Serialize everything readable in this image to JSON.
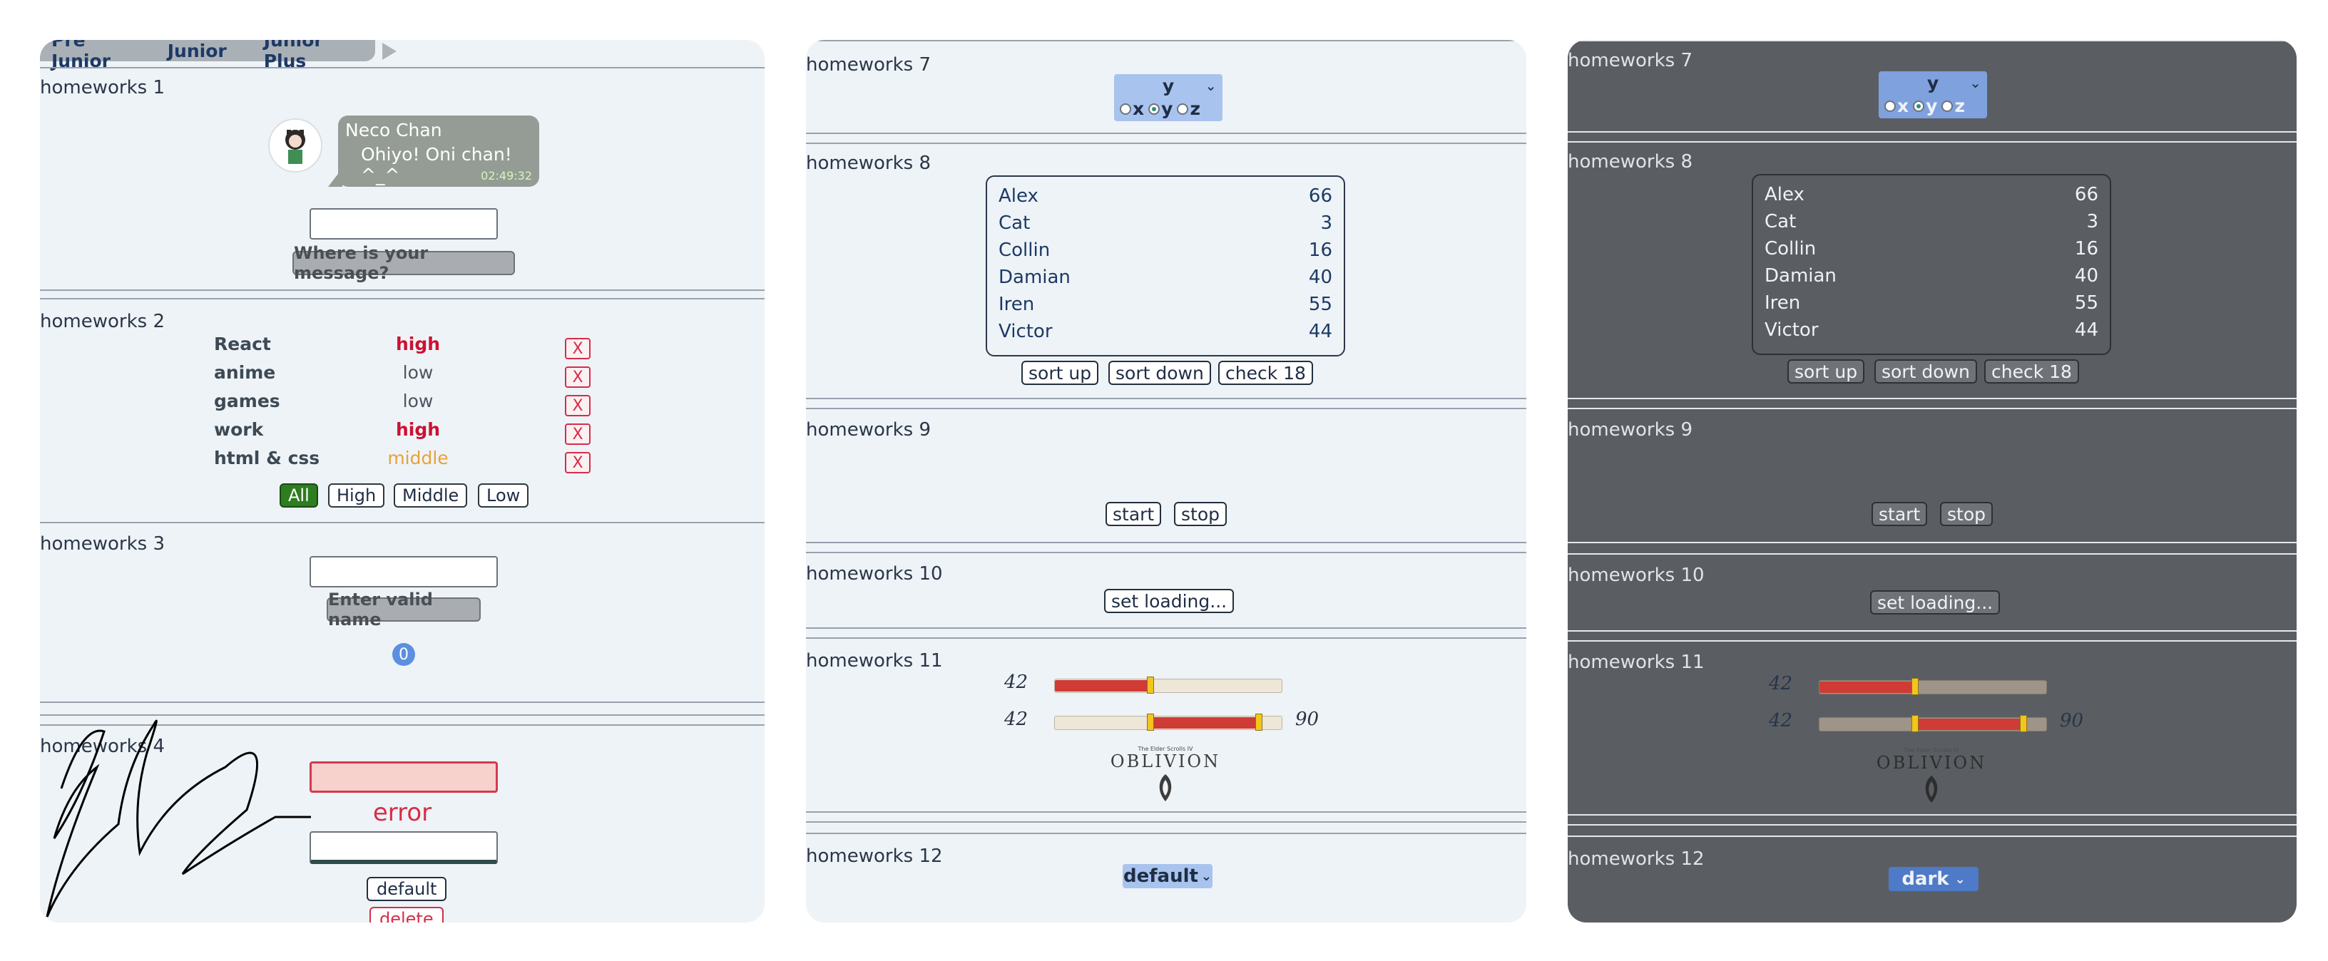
{
  "nav": {
    "levels": [
      "Pre Junior",
      "Junior",
      "Junior Plus"
    ]
  },
  "hw1": {
    "title": "homeworks 1",
    "message": {
      "name": "Neco Chan",
      "text": "Ohiyo! Oni chan! ^_^",
      "time": "02:49:32"
    },
    "input_value": "",
    "button_label": "Where is your message?"
  },
  "hw2": {
    "title": "homeworks 2",
    "affairs": [
      {
        "name": "React",
        "priority": "high",
        "delete": "X"
      },
      {
        "name": "anime",
        "priority": "low",
        "delete": "X"
      },
      {
        "name": "games",
        "priority": "low",
        "delete": "X"
      },
      {
        "name": "work",
        "priority": "high",
        "delete": "X"
      },
      {
        "name": "html & css",
        "priority": "middle",
        "delete": "X"
      }
    ],
    "filters": [
      "All",
      "High",
      "Middle",
      "Low"
    ],
    "active_filter": "All"
  },
  "hw3": {
    "title": "homeworks 3",
    "input_value": "",
    "button_label": "Enter valid name",
    "count": "0"
  },
  "hw4": {
    "title": "homeworks 4",
    "error_text": "error",
    "default_button": "default",
    "delete_button": "delete"
  },
  "hw7": {
    "title": "homeworks 7",
    "selected": "y",
    "options": [
      "x",
      "y",
      "z"
    ]
  },
  "hw8": {
    "title": "homeworks 8",
    "people": [
      {
        "name": "Alex",
        "age": "66"
      },
      {
        "name": "Cat",
        "age": "3"
      },
      {
        "name": "Collin",
        "age": "16"
      },
      {
        "name": "Damian",
        "age": "40"
      },
      {
        "name": "Iren",
        "age": "55"
      },
      {
        "name": "Victor",
        "age": "44"
      }
    ],
    "buttons": {
      "sort_up": "sort up",
      "sort_down": "sort down",
      "check": "check 18"
    }
  },
  "hw9": {
    "title": "homeworks 9",
    "buttons": {
      "start": "start",
      "stop": "stop"
    }
  },
  "hw10": {
    "title": "homeworks 10",
    "button": "set loading..."
  },
  "hw11": {
    "title": "homeworks 11",
    "range1": {
      "label": "42",
      "value": 42
    },
    "range2": {
      "min_label": "42",
      "max_label": "90",
      "min": 42,
      "max": 90
    },
    "logo": {
      "small": "The Elder Scrolls IV",
      "big": "OBLIVION"
    }
  },
  "hw12": {
    "title": "homeworks 12",
    "theme_light": "default",
    "theme_dark": "dark"
  },
  "colors": {
    "panel_light": "#eef3f7",
    "panel_dark": "#5a5e63",
    "priority_high": "#cc1133",
    "priority_middle": "#e6a33b",
    "range_fill": "#cf3b35",
    "select_bg": "#a8c3ee"
  }
}
